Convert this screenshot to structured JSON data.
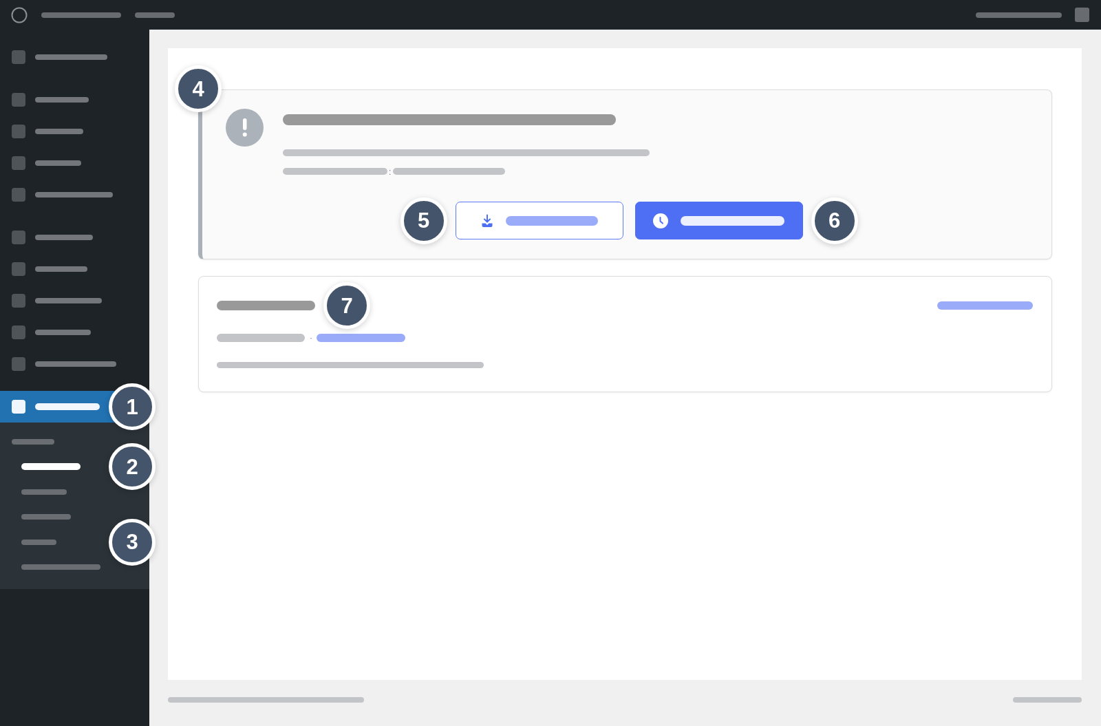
{
  "sidebar": {
    "groups": [
      {
        "items": [
          {
            "selected": false
          }
        ]
      },
      {
        "items": [
          {
            "selected": false
          },
          {
            "selected": false
          },
          {
            "selected": false
          },
          {
            "selected": false
          }
        ]
      },
      {
        "items": [
          {
            "selected": false
          },
          {
            "selected": false
          },
          {
            "selected": false
          },
          {
            "selected": false
          },
          {
            "selected": false
          }
        ]
      },
      {
        "items": [
          {
            "selected": true,
            "callout": "1"
          }
        ]
      }
    ],
    "submenu": {
      "items": [
        {
          "selected": true,
          "callout": "2"
        },
        {
          "selected": false
        },
        {
          "selected": false
        },
        {
          "selected": false,
          "callout": "3"
        },
        {
          "selected": false
        }
      ]
    }
  },
  "notice": {
    "callout": "4",
    "separator": ":",
    "buttons": [
      {
        "kind": "outline",
        "callout": "5"
      },
      {
        "kind": "primary",
        "callout": "6"
      }
    ]
  },
  "card": {
    "callout": "7",
    "separator": "·"
  }
}
